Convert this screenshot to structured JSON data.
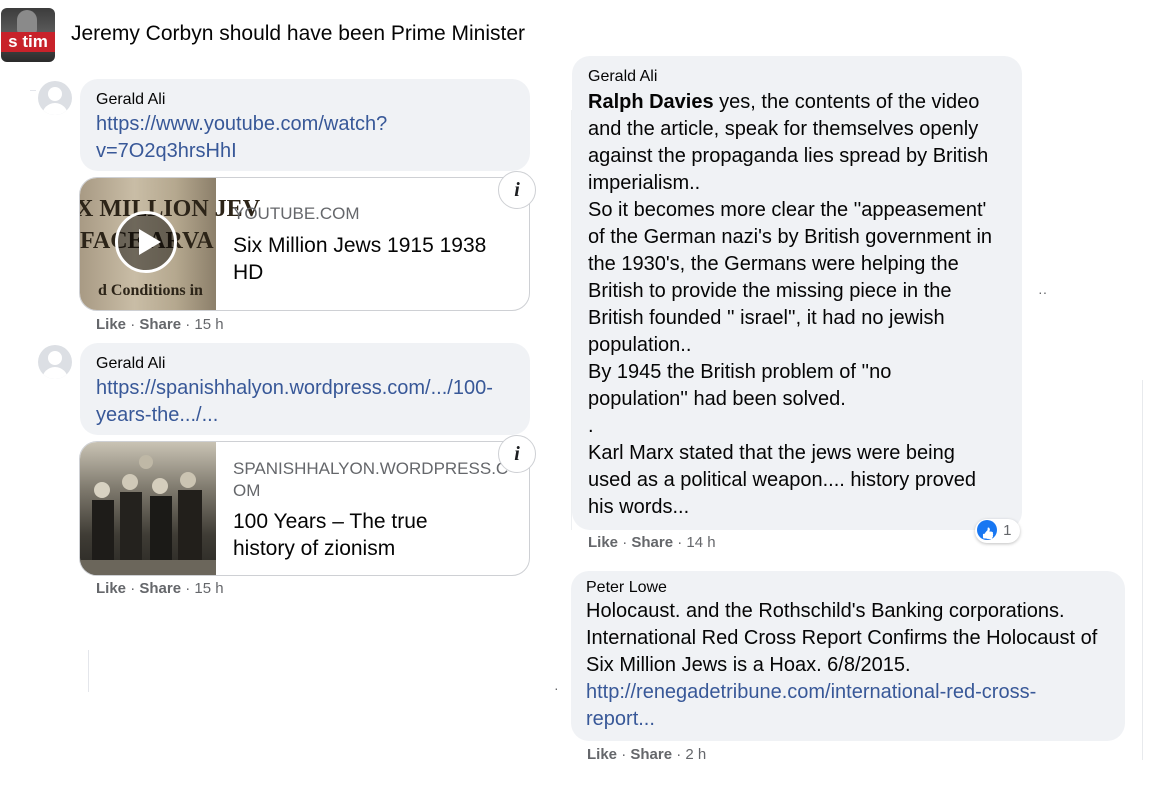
{
  "group": {
    "avatar_text": "s tim",
    "title": "Jeremy Corbyn should have been Prime Minister"
  },
  "left_comments": [
    {
      "author": "Gerald Ali",
      "link_line1": "https://www.youtube.com/watch?",
      "link_line2": "v=7O2q3hrsHhI",
      "card": {
        "domain": "YOUTUBE.COM",
        "title_line1": "Six Million Jews 1915 1938",
        "title_line2": "HD",
        "thumb_text1": "X MILLION JEV",
        "thumb_text2": "FACE  ARVA",
        "thumb_text3": "d  Conditions  in"
      },
      "like": "Like",
      "share": "Share",
      "time": "15 h"
    },
    {
      "author": "Gerald Ali",
      "link_line1": "https://spanishhalyon.wordpress.com/.../100-",
      "link_line2": "years-the.../...",
      "card": {
        "domain_line1": "SPANISHHALYON.WORDPRESS.C",
        "domain_line2": "OM",
        "title_line1": "100 Years – The true",
        "title_line2": "history of zionism"
      },
      "like": "Like",
      "share": "Share",
      "time": "15 h"
    }
  ],
  "right_comments": [
    {
      "author": "Gerald Ali",
      "mention": "Ralph Davies",
      "lines": [
        " yes, the contents of the video",
        "and the article, speak for themselves openly",
        "against the propaganda lies spread by British",
        "imperialism..",
        "So it becomes more clear the ''appeasement'",
        "of the German nazi's by British government in",
        "the 1930's, the Germans were helping the",
        "British to provide the missing piece in the",
        "British founded '' israel'', it had no jewish",
        "population..",
        "By 1945 the British problem of ''no",
        "population'' had been solved.",
        ".",
        "Karl Marx stated that the jews were being",
        "used as a political weapon.... history proved",
        "his words..."
      ],
      "reaction_count": "1",
      "like": "Like",
      "share": "Share",
      "time": "14 h"
    },
    {
      "author": "Peter Lowe",
      "lines": [
        "Holocaust. and the Rothschild's Banking corporations.",
        "International Red Cross Report Confirms the Holocaust of",
        "Six Million Jews is a Hoax. 6/8/2015."
      ],
      "link_line1": "http://renegadetribune.com/international-red-cross-",
      "link_line2": "report...",
      "like": "Like",
      "share": "Share",
      "time": "2 h"
    }
  ],
  "separator": "·",
  "icons": {
    "info": "info-icon",
    "play": "play-icon",
    "like_reaction": "like-reaction-icon",
    "more": "more-options-icon"
  },
  "colors": {
    "link": "#385898",
    "bubble": "#f0f2f5",
    "meta": "#65676b",
    "reaction_blue": "#1877f2"
  }
}
